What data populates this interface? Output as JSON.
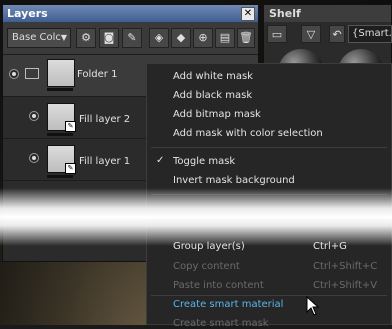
{
  "layers_panel": {
    "title": "Layers",
    "close_label": "✕",
    "channel_select": "Base Colc",
    "layers": [
      {
        "name": "Folder 1"
      },
      {
        "name": "Fill layer 2"
      },
      {
        "name": "Fill layer 1"
      }
    ]
  },
  "shelf_panel": {
    "title": "Shelf",
    "search_value": "{Smart."
  },
  "context_menu": {
    "items": [
      {
        "label": "Add white mask",
        "shortcut": "",
        "state": "normal"
      },
      {
        "label": "Add black mask",
        "shortcut": "",
        "state": "normal"
      },
      {
        "label": "Add bitmap mask",
        "shortcut": "",
        "state": "normal"
      },
      {
        "label": "Add mask with color selection",
        "shortcut": "",
        "state": "normal"
      },
      {
        "label": "Toggle mask",
        "shortcut": "",
        "state": "checked"
      },
      {
        "label": "Invert mask background",
        "shortcut": "",
        "state": "normal"
      },
      {
        "label": "Group layer(s)",
        "shortcut": "Ctrl+G",
        "state": "normal"
      },
      {
        "label": "Copy content",
        "shortcut": "Ctrl+Shift+C",
        "state": "disabled"
      },
      {
        "label": "Paste into content",
        "shortcut": "Ctrl+Shift+V",
        "state": "disabled"
      },
      {
        "label": "Create smart material",
        "shortcut": "",
        "state": "highlighted"
      },
      {
        "label": "Create smart mask",
        "shortcut": "",
        "state": "disabled"
      }
    ]
  },
  "colors": {
    "accent": "#5bb6e8",
    "title_bar": "#4f6ea3"
  }
}
